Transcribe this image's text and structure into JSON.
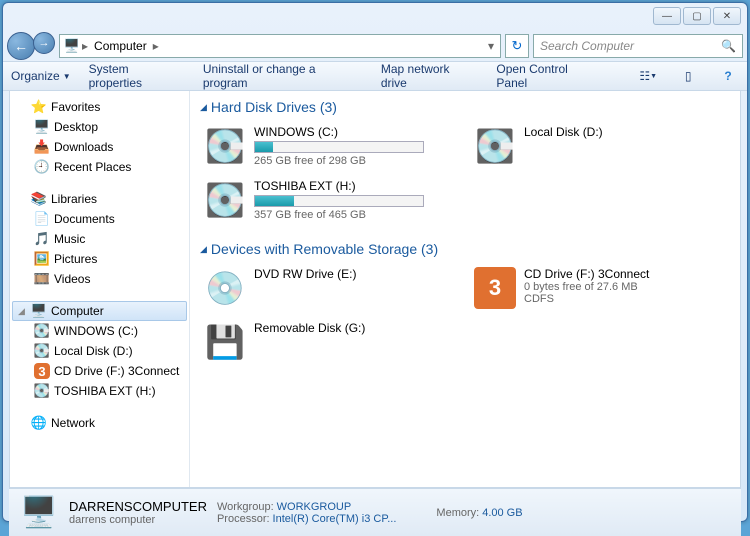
{
  "window_controls": {
    "min": "—",
    "max": "▢",
    "close": "✕"
  },
  "address": {
    "root": "Computer"
  },
  "search": {
    "placeholder": "Search Computer"
  },
  "toolbar": {
    "organize": "Organize",
    "sysprops": "System properties",
    "uninstall": "Uninstall or change a program",
    "mapdrive": "Map network drive",
    "controlpanel": "Open Control Panel"
  },
  "sidebar": {
    "favorites": {
      "label": "Favorites",
      "items": [
        "Desktop",
        "Downloads",
        "Recent Places"
      ]
    },
    "libraries": {
      "label": "Libraries",
      "items": [
        "Documents",
        "Music",
        "Pictures",
        "Videos"
      ]
    },
    "computer": {
      "label": "Computer",
      "items": [
        "WINDOWS (C:)",
        "Local Disk (D:)",
        "CD Drive (F:) 3Connect",
        "TOSHIBA EXT (H:)"
      ]
    },
    "network": {
      "label": "Network"
    }
  },
  "sections": {
    "hdd": {
      "title": "Hard Disk Drives (3)"
    },
    "removable": {
      "title": "Devices with Removable Storage (3)"
    }
  },
  "drives": {
    "c": {
      "name": "WINDOWS (C:)",
      "free": "265 GB free of 298 GB",
      "pct": 11
    },
    "d": {
      "name": "Local Disk (D:)"
    },
    "h": {
      "name": "TOSHIBA EXT (H:)",
      "free": "357 GB free of 465 GB",
      "pct": 23
    },
    "e": {
      "name": "DVD RW Drive (E:)"
    },
    "f": {
      "name": "CD Drive (F:) 3Connect",
      "free": "0 bytes free of 27.6 MB",
      "fs": "CDFS"
    },
    "g": {
      "name": "Removable Disk (G:)"
    }
  },
  "details": {
    "name": "DARRENSCOMPUTER",
    "sub": "darrens computer",
    "workgroup_l": "Workgroup:",
    "workgroup_v": "WORKGROUP",
    "processor_l": "Processor:",
    "processor_v": "Intel(R) Core(TM) i3 CP...",
    "memory_l": "Memory:",
    "memory_v": "4.00 GB"
  }
}
